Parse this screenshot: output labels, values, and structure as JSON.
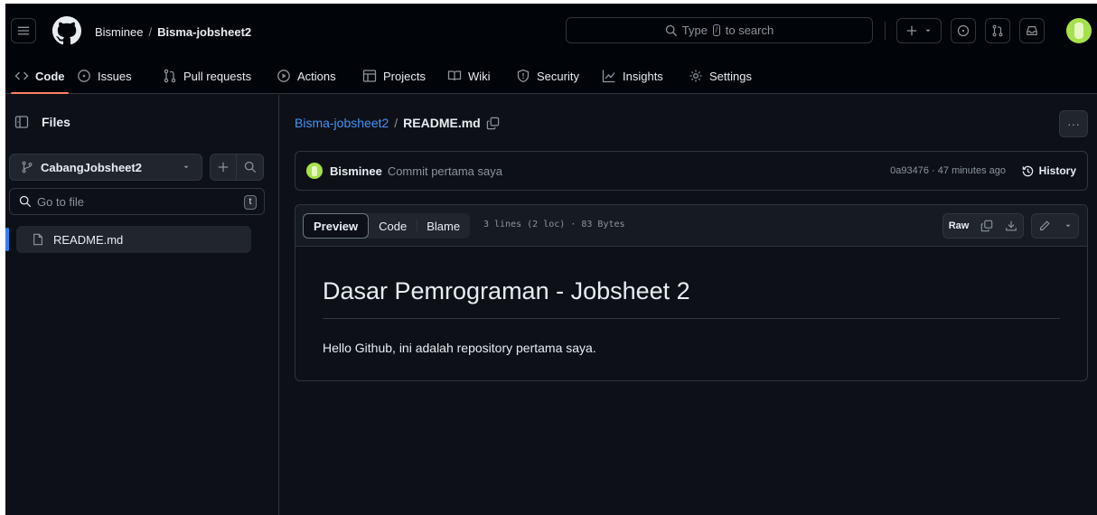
{
  "header": {
    "owner": "Bisminee",
    "repo": "Bisma-jobsheet2",
    "search_prefix": "Type",
    "search_key": "/",
    "search_suffix": "to search"
  },
  "tabs": [
    {
      "label": "Code",
      "icon": "code-icon",
      "active": true
    },
    {
      "label": "Issues",
      "icon": "issue-icon"
    },
    {
      "label": "Pull requests",
      "icon": "pull-request-icon"
    },
    {
      "label": "Actions",
      "icon": "play-icon"
    },
    {
      "label": "Projects",
      "icon": "table-icon"
    },
    {
      "label": "Wiki",
      "icon": "book-icon"
    },
    {
      "label": "Security",
      "icon": "shield-icon"
    },
    {
      "label": "Insights",
      "icon": "graph-icon"
    },
    {
      "label": "Settings",
      "icon": "gear-icon"
    }
  ],
  "sidebar": {
    "title": "Files",
    "branch": "CabangJobsheet2",
    "goto_placeholder": "Go to file",
    "goto_key": "t",
    "files": [
      "README.md"
    ]
  },
  "path": {
    "repo": "Bisma-jobsheet2",
    "file": "README.md"
  },
  "commit": {
    "author": "Bisminee",
    "message": "Commit pertama saya",
    "meta": "0a93476 · 47 minutes ago",
    "history_label": "History"
  },
  "file": {
    "views": [
      "Preview",
      "Code",
      "Blame"
    ],
    "active_view": "Preview",
    "meta": "3 lines (2 loc) · 83 Bytes",
    "raw_label": "Raw"
  },
  "readme": {
    "heading": "Dasar Pemrograman - Jobsheet 2",
    "body": "Hello Github, ini adalah repository pertama saya."
  },
  "colors": {
    "background": "#0d1117",
    "header_bg": "#010409",
    "border": "#30363d",
    "accent_link": "#4493f8",
    "active_tab_underline": "#f78166",
    "avatar": "#a6e14b"
  }
}
